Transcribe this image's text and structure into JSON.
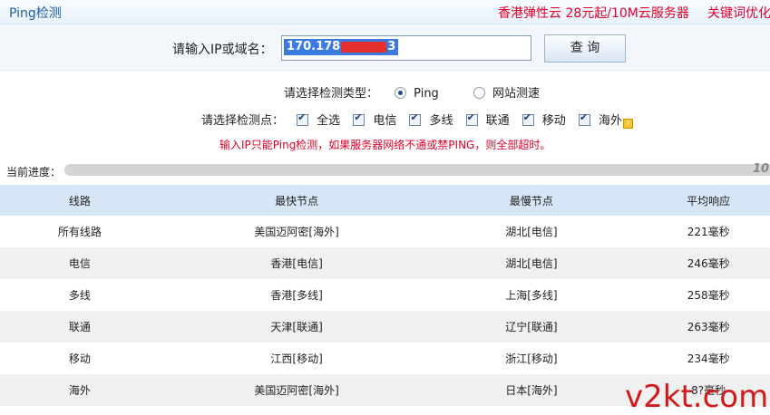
{
  "header": {
    "tab_title": "Ping检测",
    "promo_left": "香港弹性云 28元起/10M云服务器",
    "promo_right": "关键词优化"
  },
  "search": {
    "label": "请输入IP或域名：",
    "value_prefix": "170.178",
    "value_suffix": "3",
    "button": "查 询"
  },
  "detect_type": {
    "label": "请选择检测类型：",
    "options": [
      {
        "label": "Ping",
        "selected": true
      },
      {
        "label": "网站测速",
        "selected": false
      }
    ]
  },
  "nodes": {
    "label": "请选择检测点：",
    "items": [
      {
        "label": "全选",
        "checked": true
      },
      {
        "label": "电信",
        "checked": true
      },
      {
        "label": "多线",
        "checked": true
      },
      {
        "label": "联通",
        "checked": true
      },
      {
        "label": "移动",
        "checked": true
      },
      {
        "label": "海外",
        "checked": true
      }
    ]
  },
  "warning": "输入IP只能Ping检测，如果服务器网络不通或禁PING，则全部超时。",
  "progress": {
    "label": "当前进度：",
    "text": "10",
    "percent": 100
  },
  "table": {
    "headers": [
      "线路",
      "最快节点",
      "最慢节点",
      "平均响应"
    ],
    "rows": [
      [
        "所有线路",
        "美国迈阿密[海外]",
        "湖北[电信]",
        "221毫秒"
      ],
      [
        "电信",
        "香港[电信]",
        "湖北[电信]",
        "246毫秒"
      ],
      [
        "多线",
        "香港[多线]",
        "上海[多线]",
        "258毫秒"
      ],
      [
        "联通",
        "天津[联通]",
        "辽宁[联通]",
        "263毫秒"
      ],
      [
        "移动",
        "江西[移动]",
        "浙江[移动]",
        "234毫秒"
      ],
      [
        "海外",
        "美国迈阿密[海外]",
        "日本[海外]",
        "8?毫秒"
      ]
    ]
  },
  "watermark": "v2kt.com",
  "colors": {
    "accent_red": "#e0002a",
    "header_blue": "#d7e6f6",
    "title_blue": "#1d5fa6"
  }
}
